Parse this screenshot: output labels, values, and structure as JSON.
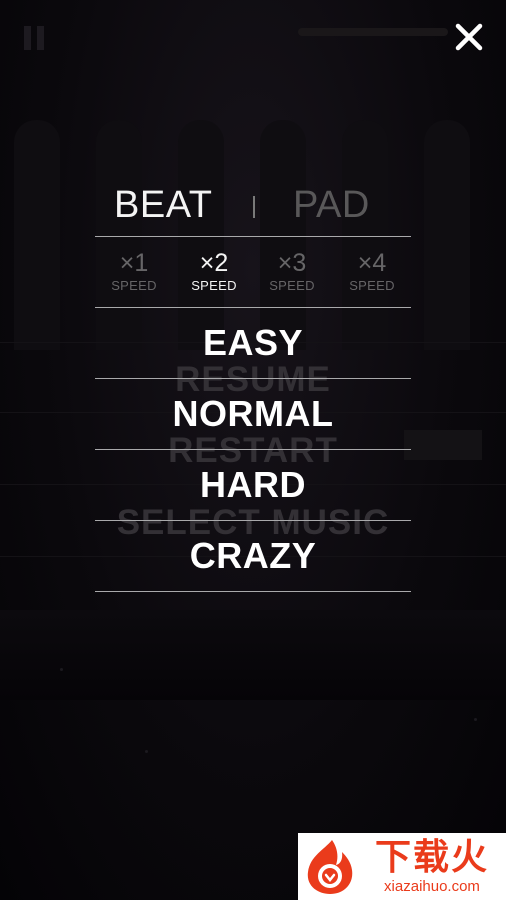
{
  "background": {
    "ghost_menu": [
      "RESUME",
      "RESTART",
      "SELECT MUSIC"
    ]
  },
  "close_icon": "close-icon",
  "mode_tabs": [
    {
      "label": "BEAT",
      "active": true
    },
    {
      "label": "PAD",
      "active": false
    }
  ],
  "speed_options": [
    {
      "multiplier": "×1",
      "label": "SPEED",
      "active": false
    },
    {
      "multiplier": "×2",
      "label": "SPEED",
      "active": true
    },
    {
      "multiplier": "×3",
      "label": "SPEED",
      "active": false
    },
    {
      "multiplier": "×4",
      "label": "SPEED",
      "active": false
    }
  ],
  "difficulties": [
    "EASY",
    "NORMAL",
    "HARD",
    "CRAZY"
  ],
  "watermark": {
    "brand_text": "下载火",
    "url": "xiazaihuo.com",
    "color": "#ea3b1b"
  },
  "colors": {
    "text_active": "#f4f4f4",
    "text_inactive": "#666567",
    "divider": "#a9a9ab",
    "background": "#050407"
  }
}
